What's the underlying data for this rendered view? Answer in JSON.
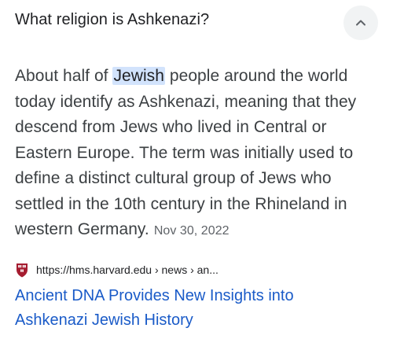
{
  "question": {
    "text": "What religion is Ashkenazi?",
    "toggle_icon": "chevron-up-icon"
  },
  "answer": {
    "prefix": "About half of",
    "highlighted": "Jewish",
    "body": "people around the world today identify as Ashkenazi, meaning that they descend from Jews who lived in Central or Eastern Europe. The term was initially used to define a distinct cultural group of Jews who settled in the 10th century in the Rhineland in western Germany.",
    "date": "Nov 30, 2022"
  },
  "source": {
    "favicon": "harvard-shield-icon",
    "url": "https://hms.harvard.edu › news › an...",
    "title": "Ancient DNA Provides New Insights into Ashkenazi Jewish History"
  },
  "colors": {
    "link": "#1a5bc8",
    "highlight": "#d2e3fc",
    "harvard_crimson": "#a51c30"
  }
}
